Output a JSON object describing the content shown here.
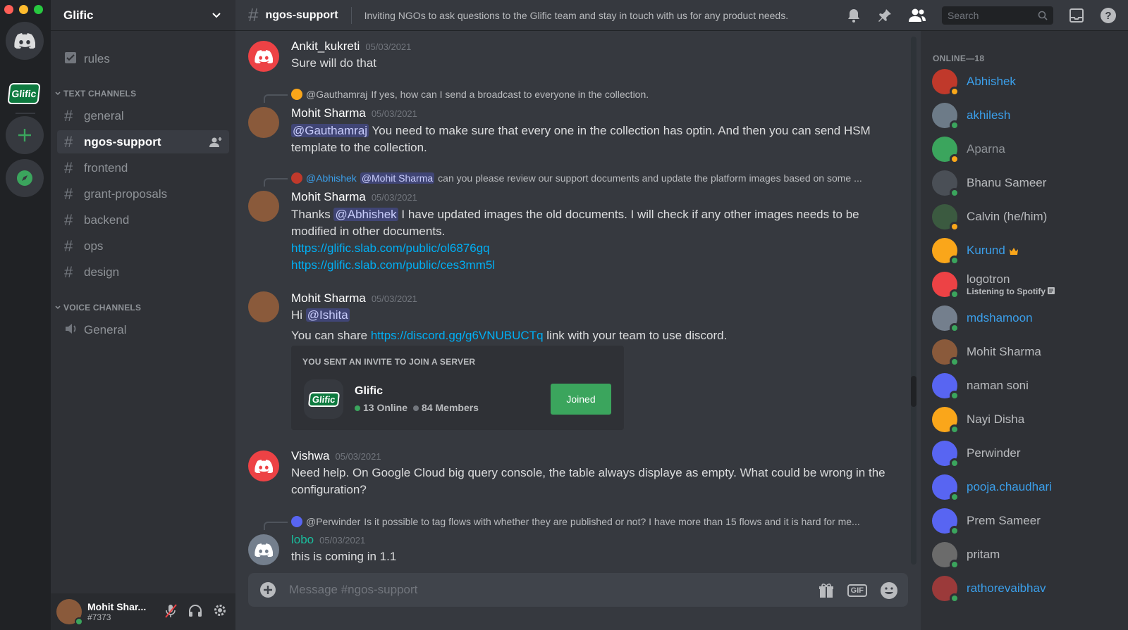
{
  "server": {
    "name": "Glific",
    "logo_text": "Glific"
  },
  "sidebar": {
    "rules": "rules",
    "text_category": "TEXT CHANNELS",
    "voice_category": "VOICE CHANNELS",
    "channels": [
      {
        "name": "general"
      },
      {
        "name": "ngos-support"
      },
      {
        "name": "frontend"
      },
      {
        "name": "grant-proposals"
      },
      {
        "name": "backend"
      },
      {
        "name": "ops"
      },
      {
        "name": "design"
      }
    ],
    "voice": "General"
  },
  "user": {
    "name": "Mohit Shar...",
    "discriminator": "#7373"
  },
  "topbar": {
    "channel": "ngos-support",
    "topic": "Inviting NGOs to ask questions to the Glific team and stay in touch with us for any product needs.",
    "search_placeholder": "Search"
  },
  "messages": [
    {
      "author": "Ankit_kukreti",
      "time": "05/03/2021",
      "text": "Sure will do that"
    },
    {
      "reply_author": "@Gauthamraj",
      "reply_text": "If yes, how can I send a broadcast to everyone in the collection.",
      "author": "Mohit Sharma",
      "time": "05/03/2021",
      "mention": "@Gauthamraj",
      "text": "You need to make sure that every one in the collection has optin. And then you can send HSM template to the collection."
    },
    {
      "reply_author": "@Abhishek",
      "reply_mention": "@Mohit Sharma",
      "reply_text": "can you please review our support documents and update the platform images based on some ...",
      "author": "Mohit Sharma",
      "time": "05/03/2021",
      "text_pre": "Thanks",
      "mention": "@Abhishek",
      "text": "I have updated images the old documents. I will check if any other images needs to be modified in other documents.",
      "link1": "https://glific.slab.com/public/ol6876gq",
      "link2": "https://glific.slab.com/public/ces3mm5l"
    },
    {
      "author": "Mohit Sharma",
      "time": "05/03/2021",
      "text_pre": "Hi",
      "mention": "@Ishita",
      "line2_pre": "You can share",
      "link": "https://discord.gg/g6VNUBUCTq",
      "line2_post": "link with your team to use discord.",
      "invite": {
        "header": "YOU SENT AN INVITE TO JOIN A SERVER",
        "server": "Glific",
        "online": "13 Online",
        "members": "84 Members",
        "button": "Joined"
      }
    },
    {
      "author": "Vishwa",
      "time": "05/03/2021",
      "text": "Need help. On Google Cloud big query console, the table always displaye as empty. What could be wrong in the configuration?"
    },
    {
      "reply_author": "@Perwinder",
      "reply_text": "Is it possible to tag flows with whether they are published or not? I have more than 15 flows and it is hard for me...",
      "author": "lobo",
      "time": "05/03/2021",
      "text": "this is coming in 1.1"
    }
  ],
  "composer": {
    "placeholder": "Message #ngos-support",
    "gif": "GIF"
  },
  "members": {
    "header": "ONLINE—18",
    "spotify_sub": "Listening to Spotify",
    "list": [
      {
        "name": "Abhishek"
      },
      {
        "name": "akhilesh"
      },
      {
        "name": "Aparna"
      },
      {
        "name": "Bhanu Sameer"
      },
      {
        "name": "Calvin (he/him)"
      },
      {
        "name": "Kurund"
      },
      {
        "name": "logotron"
      },
      {
        "name": "mdshamoon"
      },
      {
        "name": "Mohit Sharma"
      },
      {
        "name": "naman soni"
      },
      {
        "name": "Nayi Disha"
      },
      {
        "name": "Perwinder"
      },
      {
        "name": "pooja.chaudhari"
      },
      {
        "name": "Prem Sameer"
      },
      {
        "name": "pritam"
      },
      {
        "name": "rathorevaibhav"
      }
    ]
  },
  "colors": {
    "accent": "#5865f2",
    "online": "#3ba55d",
    "idle": "#faa81a",
    "link": "#00aff4"
  }
}
